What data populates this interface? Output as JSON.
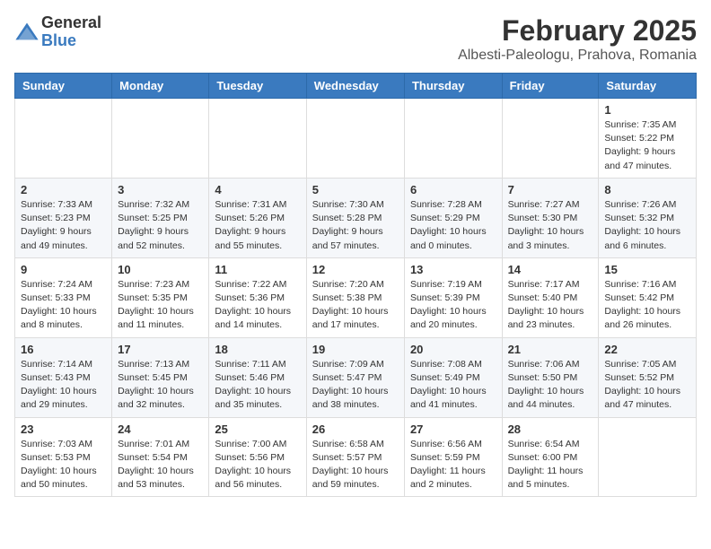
{
  "logo": {
    "general": "General",
    "blue": "Blue"
  },
  "header": {
    "month": "February 2025",
    "location": "Albesti-Paleologu, Prahova, Romania"
  },
  "weekdays": [
    "Sunday",
    "Monday",
    "Tuesday",
    "Wednesday",
    "Thursday",
    "Friday",
    "Saturday"
  ],
  "weeks": [
    [
      {
        "day": "",
        "info": ""
      },
      {
        "day": "",
        "info": ""
      },
      {
        "day": "",
        "info": ""
      },
      {
        "day": "",
        "info": ""
      },
      {
        "day": "",
        "info": ""
      },
      {
        "day": "",
        "info": ""
      },
      {
        "day": "1",
        "info": "Sunrise: 7:35 AM\nSunset: 5:22 PM\nDaylight: 9 hours and 47 minutes."
      }
    ],
    [
      {
        "day": "2",
        "info": "Sunrise: 7:33 AM\nSunset: 5:23 PM\nDaylight: 9 hours and 49 minutes."
      },
      {
        "day": "3",
        "info": "Sunrise: 7:32 AM\nSunset: 5:25 PM\nDaylight: 9 hours and 52 minutes."
      },
      {
        "day": "4",
        "info": "Sunrise: 7:31 AM\nSunset: 5:26 PM\nDaylight: 9 hours and 55 minutes."
      },
      {
        "day": "5",
        "info": "Sunrise: 7:30 AM\nSunset: 5:28 PM\nDaylight: 9 hours and 57 minutes."
      },
      {
        "day": "6",
        "info": "Sunrise: 7:28 AM\nSunset: 5:29 PM\nDaylight: 10 hours and 0 minutes."
      },
      {
        "day": "7",
        "info": "Sunrise: 7:27 AM\nSunset: 5:30 PM\nDaylight: 10 hours and 3 minutes."
      },
      {
        "day": "8",
        "info": "Sunrise: 7:26 AM\nSunset: 5:32 PM\nDaylight: 10 hours and 6 minutes."
      }
    ],
    [
      {
        "day": "9",
        "info": "Sunrise: 7:24 AM\nSunset: 5:33 PM\nDaylight: 10 hours and 8 minutes."
      },
      {
        "day": "10",
        "info": "Sunrise: 7:23 AM\nSunset: 5:35 PM\nDaylight: 10 hours and 11 minutes."
      },
      {
        "day": "11",
        "info": "Sunrise: 7:22 AM\nSunset: 5:36 PM\nDaylight: 10 hours and 14 minutes."
      },
      {
        "day": "12",
        "info": "Sunrise: 7:20 AM\nSunset: 5:38 PM\nDaylight: 10 hours and 17 minutes."
      },
      {
        "day": "13",
        "info": "Sunrise: 7:19 AM\nSunset: 5:39 PM\nDaylight: 10 hours and 20 minutes."
      },
      {
        "day": "14",
        "info": "Sunrise: 7:17 AM\nSunset: 5:40 PM\nDaylight: 10 hours and 23 minutes."
      },
      {
        "day": "15",
        "info": "Sunrise: 7:16 AM\nSunset: 5:42 PM\nDaylight: 10 hours and 26 minutes."
      }
    ],
    [
      {
        "day": "16",
        "info": "Sunrise: 7:14 AM\nSunset: 5:43 PM\nDaylight: 10 hours and 29 minutes."
      },
      {
        "day": "17",
        "info": "Sunrise: 7:13 AM\nSunset: 5:45 PM\nDaylight: 10 hours and 32 minutes."
      },
      {
        "day": "18",
        "info": "Sunrise: 7:11 AM\nSunset: 5:46 PM\nDaylight: 10 hours and 35 minutes."
      },
      {
        "day": "19",
        "info": "Sunrise: 7:09 AM\nSunset: 5:47 PM\nDaylight: 10 hours and 38 minutes."
      },
      {
        "day": "20",
        "info": "Sunrise: 7:08 AM\nSunset: 5:49 PM\nDaylight: 10 hours and 41 minutes."
      },
      {
        "day": "21",
        "info": "Sunrise: 7:06 AM\nSunset: 5:50 PM\nDaylight: 10 hours and 44 minutes."
      },
      {
        "day": "22",
        "info": "Sunrise: 7:05 AM\nSunset: 5:52 PM\nDaylight: 10 hours and 47 minutes."
      }
    ],
    [
      {
        "day": "23",
        "info": "Sunrise: 7:03 AM\nSunset: 5:53 PM\nDaylight: 10 hours and 50 minutes."
      },
      {
        "day": "24",
        "info": "Sunrise: 7:01 AM\nSunset: 5:54 PM\nDaylight: 10 hours and 53 minutes."
      },
      {
        "day": "25",
        "info": "Sunrise: 7:00 AM\nSunset: 5:56 PM\nDaylight: 10 hours and 56 minutes."
      },
      {
        "day": "26",
        "info": "Sunrise: 6:58 AM\nSunset: 5:57 PM\nDaylight: 10 hours and 59 minutes."
      },
      {
        "day": "27",
        "info": "Sunrise: 6:56 AM\nSunset: 5:59 PM\nDaylight: 11 hours and 2 minutes."
      },
      {
        "day": "28",
        "info": "Sunrise: 6:54 AM\nSunset: 6:00 PM\nDaylight: 11 hours and 5 minutes."
      },
      {
        "day": "",
        "info": ""
      }
    ]
  ]
}
